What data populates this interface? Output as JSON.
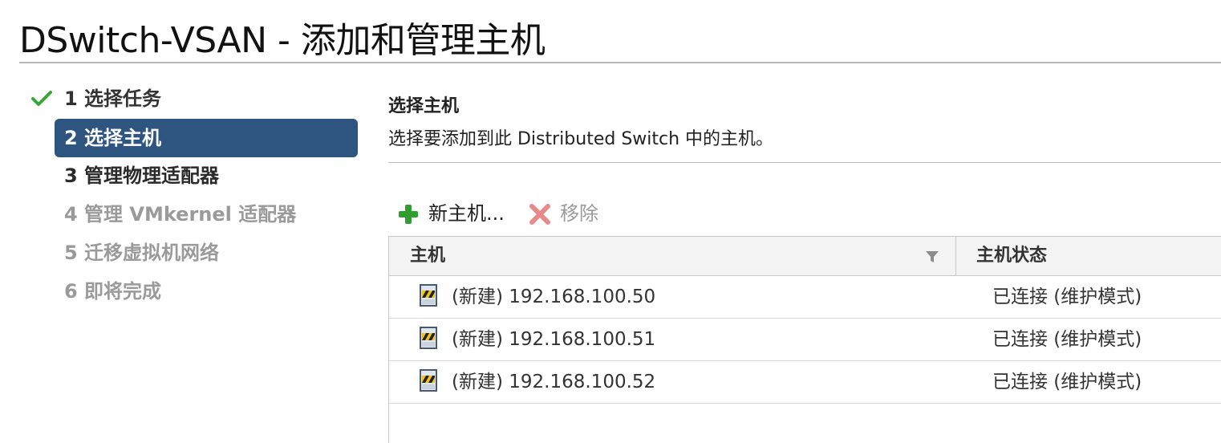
{
  "dialog": {
    "title": "DSwitch-VSAN - 添加和管理主机"
  },
  "steps": [
    {
      "label": "1 选择任务",
      "state": "done"
    },
    {
      "label": "2 选择主机",
      "state": "active"
    },
    {
      "label": "3 管理物理适配器",
      "state": "enabled"
    },
    {
      "label": "4 管理 VMkernel 适配器",
      "state": "disabled"
    },
    {
      "label": "5 迁移虚拟机网络",
      "state": "disabled"
    },
    {
      "label": "6 即将完成",
      "state": "disabled"
    }
  ],
  "panel": {
    "heading": "选择主机",
    "description": "选择要添加到此 Distributed Switch 中的主机。"
  },
  "toolbar": {
    "add_label": "新主机...",
    "remove_label": "移除"
  },
  "grid": {
    "columns": [
      "主机",
      "主机状态"
    ],
    "rows": [
      {
        "host": "(新建) 192.168.100.50",
        "status": "已连接 (维护模式)"
      },
      {
        "host": "(新建) 192.168.100.51",
        "status": "已连接 (维护模式)"
      },
      {
        "host": "(新建) 192.168.100.52",
        "status": "已连接 (维护模式)"
      }
    ]
  },
  "colors": {
    "active_step_bg": "#2d5580",
    "check_green": "#3aa53a",
    "add_green": "#2f9e2f",
    "remove_red": "#e88a8a",
    "disabled_text": "#9a9a9a"
  },
  "icons": {
    "done_step": "checkmark-icon",
    "add": "plus-icon",
    "remove": "x-icon",
    "filter": "filter-icon",
    "host": "host-maintenance-icon"
  }
}
